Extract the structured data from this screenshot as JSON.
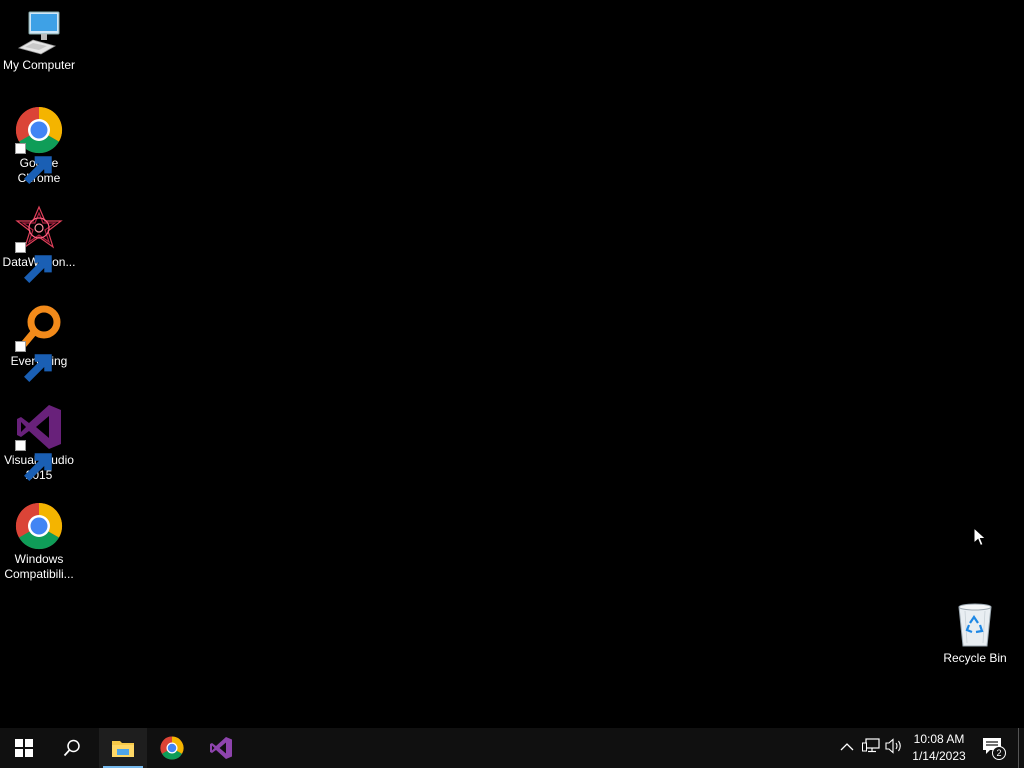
{
  "desktop": {
    "icons": [
      {
        "label": "My Computer",
        "icon": "computer-icon"
      },
      {
        "label": "Google Chrome",
        "icon": "chrome-icon"
      },
      {
        "label": "DataWagon...",
        "icon": "datawagon-icon"
      },
      {
        "label": "Everything",
        "icon": "everything-search-icon"
      },
      {
        "label": "Visual Studio 2015",
        "icon": "visual-studio-icon"
      },
      {
        "label": "Windows Compatibili...",
        "icon": "chrome-icon"
      },
      {
        "label": "Recycle Bin",
        "icon": "recycle-bin-icon"
      }
    ]
  },
  "taskbar": {
    "start_icon": "windows-logo-icon",
    "search_icon": "search-icon",
    "pinned": [
      {
        "name": "File Explorer",
        "icon": "file-explorer-icon",
        "active": true
      },
      {
        "name": "Google Chrome",
        "icon": "chrome-icon",
        "active": false
      },
      {
        "name": "Visual Studio",
        "icon": "visual-studio-icon",
        "active": false
      }
    ],
    "tray": {
      "icons": [
        "chevron-up-icon",
        "network-icon",
        "volume-icon"
      ],
      "time": "10:08 AM",
      "date": "1/14/2023",
      "notification_count": "2"
    }
  },
  "colors": {
    "desktop_background": "#000000",
    "taskbar_background": "#101010",
    "active_indicator": "#76b9ed"
  }
}
